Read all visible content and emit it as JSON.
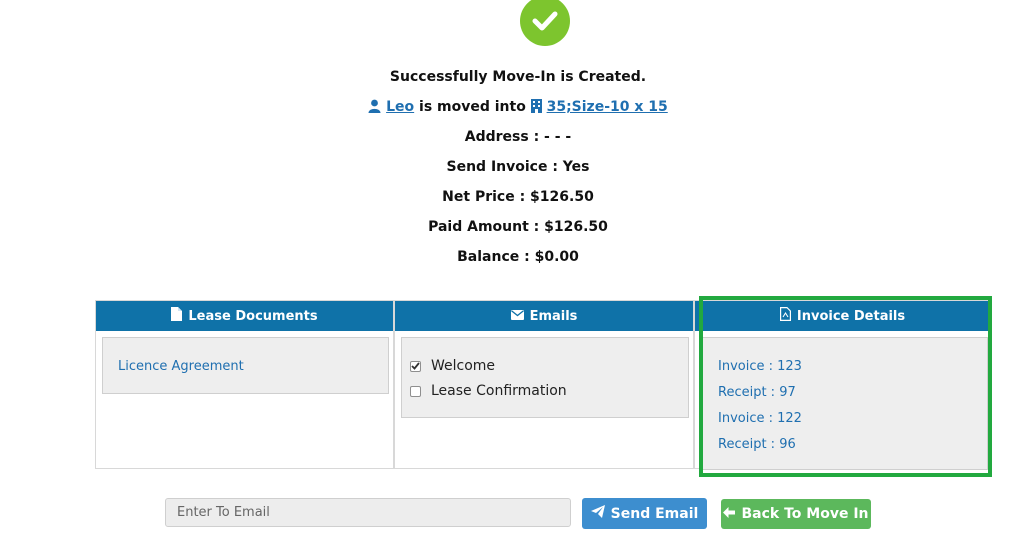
{
  "success": {
    "title": "Successfully Move-In is Created.",
    "tenant_name": "Leo",
    "moved_into_text": "is moved into",
    "unit_label": "35;Size-10 x 15",
    "address": "Address : - - -",
    "send_invoice": "Send Invoice : Yes",
    "net_price": "Net Price : $126.50",
    "paid_amount": "Paid Amount : $126.50",
    "balance": "Balance : $0.00"
  },
  "panels": {
    "lease": {
      "title": "Lease Documents",
      "items": [
        "Licence Agreement"
      ]
    },
    "emails": {
      "title": "Emails",
      "items": [
        {
          "label": "Welcome",
          "checked": true
        },
        {
          "label": "Lease Confirmation",
          "checked": false
        }
      ]
    },
    "invoice": {
      "title": "Invoice Details",
      "items": [
        "Invoice : 123",
        "Receipt : 97",
        "Invoice : 122",
        "Receipt : 96"
      ]
    }
  },
  "actions": {
    "email_placeholder": "Enter To Email",
    "send_email_label": "Send Email",
    "back_label": "Back To Move In"
  },
  "colors": {
    "success_green": "#7dc52e",
    "header_blue": "#0f72a8",
    "link_blue": "#1f6fb0",
    "send_btn": "#3d8ecf",
    "back_btn": "#5cb85c",
    "highlight": "#22a93f"
  },
  "icons": [
    "check-icon",
    "user-icon",
    "building-icon",
    "document-icon",
    "envelope-icon",
    "pdf-icon",
    "paper-plane-icon",
    "arrow-left-icon"
  ]
}
